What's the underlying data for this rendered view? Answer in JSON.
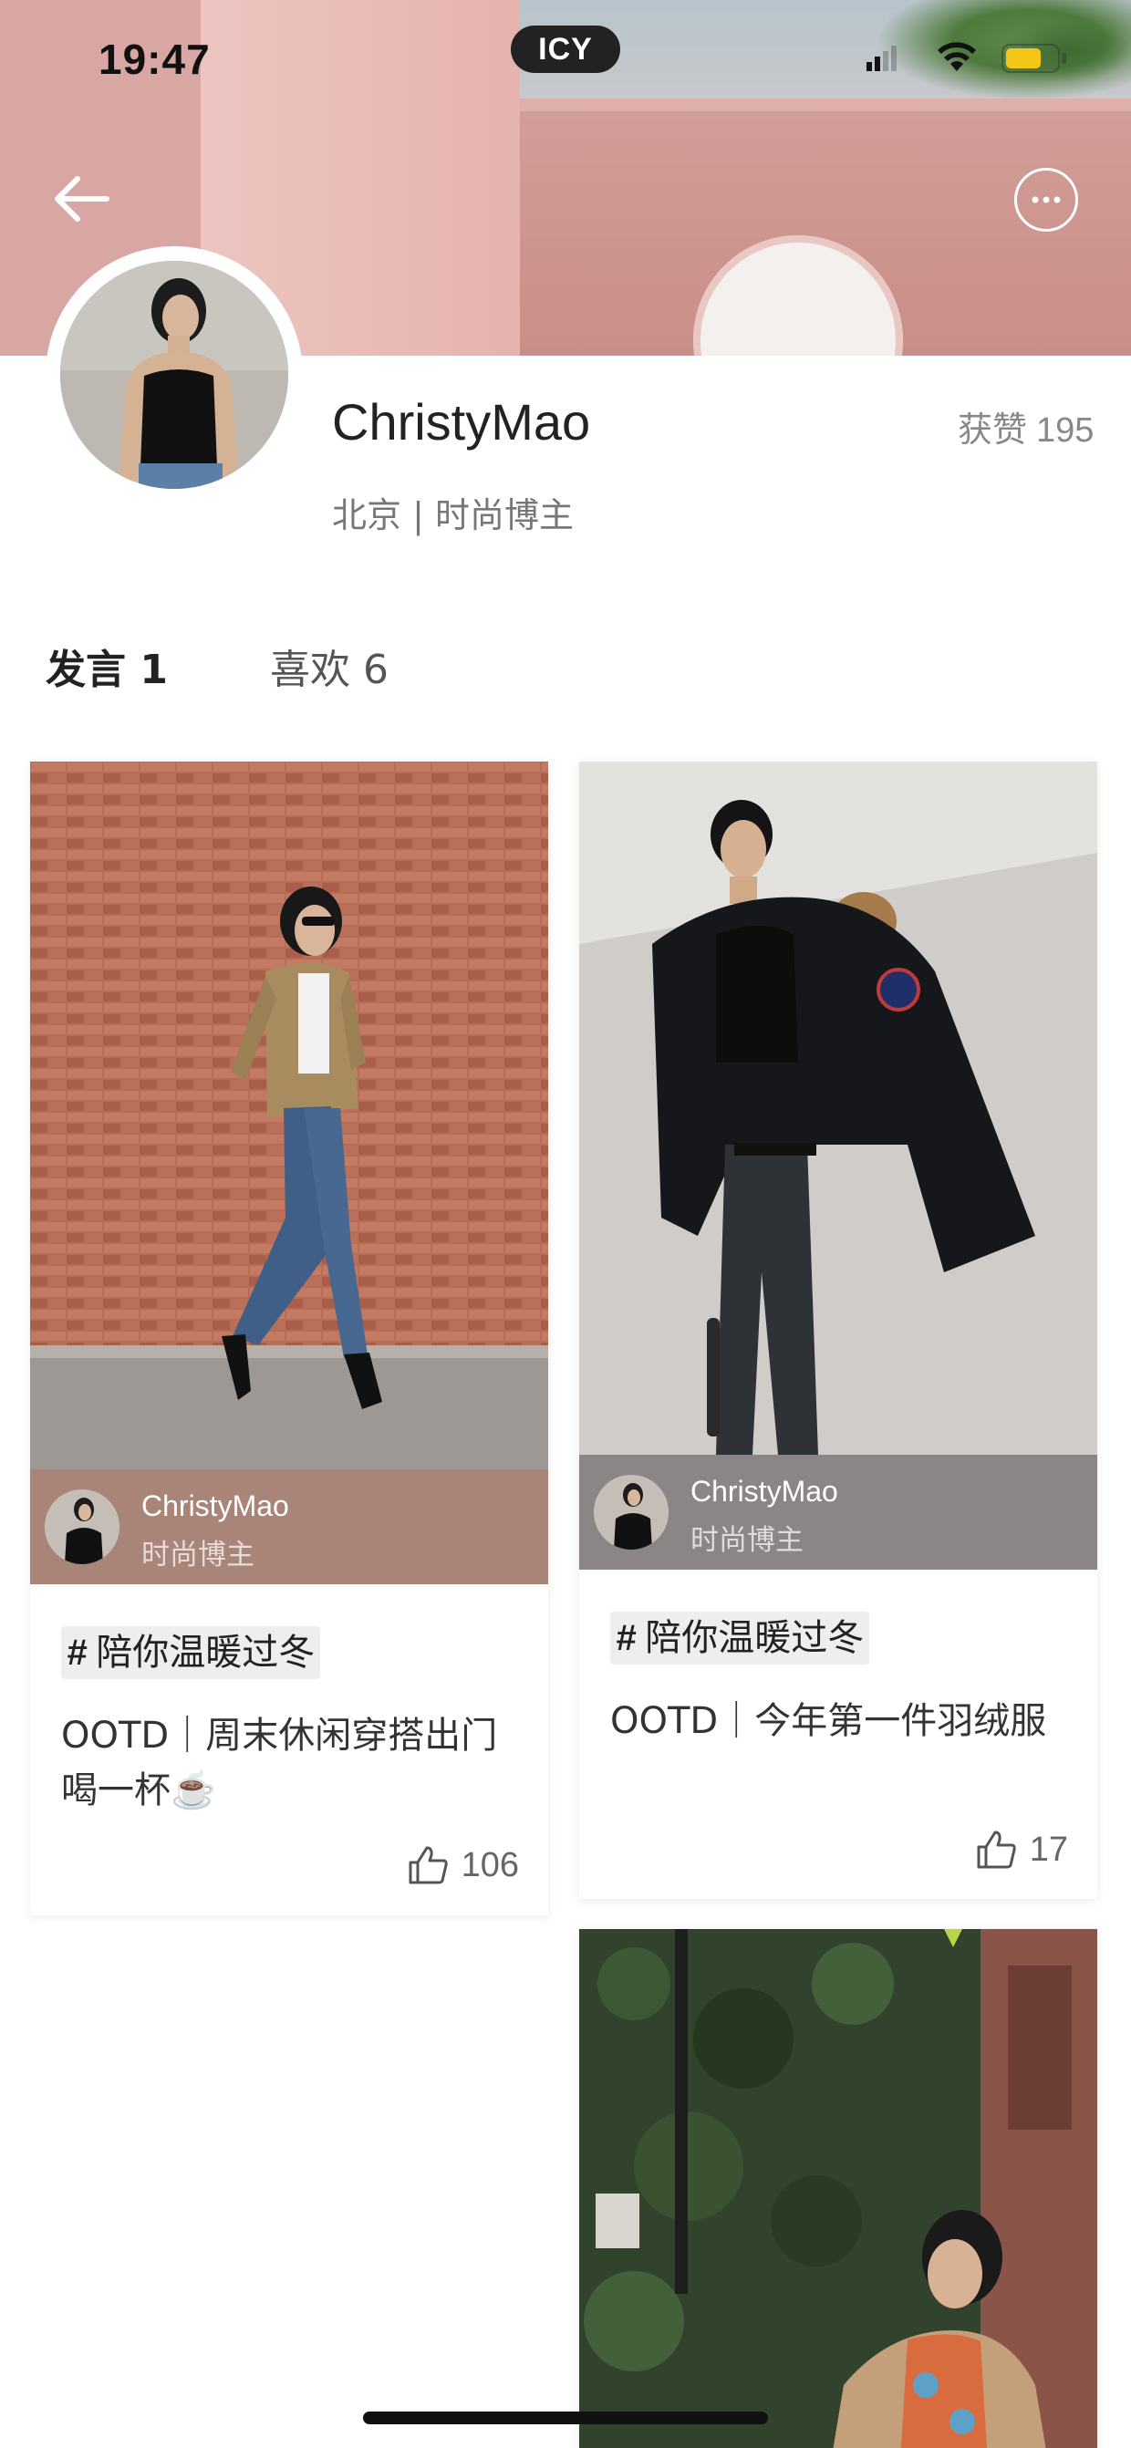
{
  "status_bar": {
    "time": "19:47",
    "carrier_pill": "ICY"
  },
  "colors": {
    "accent_underline": "#f0826a",
    "card1_author_bg": "#a88578",
    "card2_author_bg": "#8c8586"
  },
  "nav": {
    "back_icon": "arrow-left-icon",
    "more_icon": "more-horizontal-icon"
  },
  "profile": {
    "username": "ChristyMao",
    "likes_label": "获赞",
    "likes_count": "195",
    "bio": "北京 | 时尚博主"
  },
  "tabs": [
    {
      "label": "发言 1",
      "active": true
    },
    {
      "label": "喜欢 6",
      "active": false
    }
  ],
  "posts": [
    {
      "author_name": "ChristyMao",
      "author_role": "时尚博主",
      "topic": "陪你温暖过冬",
      "caption": "OOTD｜周末休闲穿搭出门喝一杯☕️",
      "likes": "106"
    },
    {
      "author_name": "ChristyMao",
      "author_role": "时尚博主",
      "topic": "陪你温暖过冬",
      "caption": "OOTD｜今年第一件羽绒服",
      "likes": "17"
    }
  ],
  "icons": {
    "topic_icon": "hash-icon",
    "like_icon": "thumbs-up-icon"
  }
}
